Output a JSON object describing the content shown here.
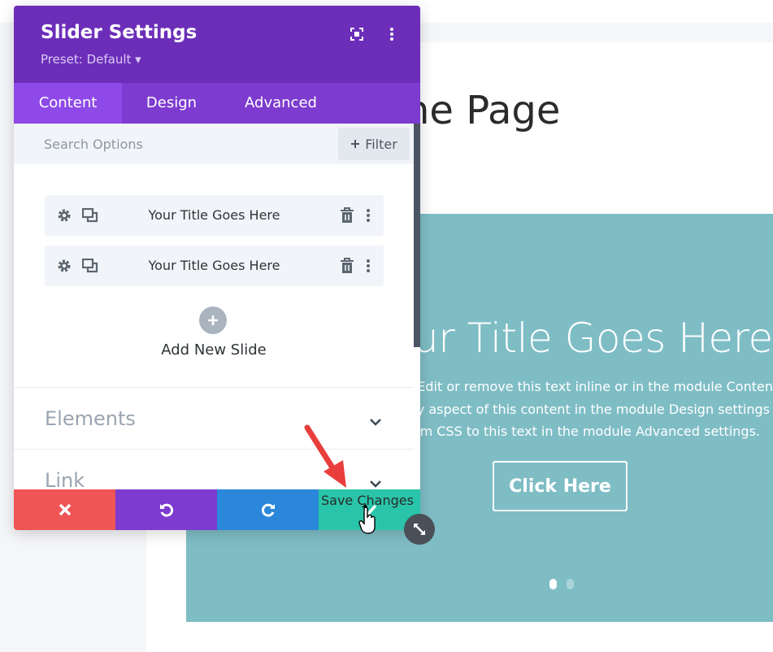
{
  "page": {
    "heading": "ne Page",
    "slider": {
      "title": "ur Title Goes Here",
      "body_lines": [
        "re. Edit or remove this text inline or in the module Conten",
        "ery aspect of this content in the module Design settings",
        "stom CSS to this text in the module Advanced settings."
      ],
      "button_label": "Click Here",
      "dots": [
        "active",
        "inactive"
      ]
    }
  },
  "panel": {
    "title": "Slider Settings",
    "preset": "Preset: Default ▾",
    "tabs": [
      {
        "label": "Content",
        "active": true
      },
      {
        "label": "Design",
        "active": false
      },
      {
        "label": "Advanced",
        "active": false
      }
    ],
    "search": {
      "placeholder": "Search Options"
    },
    "filter_label": "Filter",
    "slides": [
      {
        "label": "Your Title Goes Here"
      },
      {
        "label": "Your Title Goes Here"
      }
    ],
    "add_slide_label": "Add New Slide",
    "sections": [
      {
        "label": "Elements"
      },
      {
        "label": "Link"
      }
    ],
    "bottom_bar": {
      "save_label": "Save Changes"
    }
  },
  "colors": {
    "purple_header": "#6c2eb9",
    "purple_tabs": "#7d3bcf",
    "purple_active_tab": "#8e49e8",
    "cancel": "#ef5555",
    "undo": "#7e3bd0",
    "redo": "#2b87da",
    "save": "#29c4a9",
    "slider_bg": "#7fbdc5"
  },
  "icons": [
    "focus-icon",
    "more-vertical-icon",
    "search-icon",
    "plus-icon",
    "gear-icon",
    "duplicate-icon",
    "trash-icon",
    "kebab-icon",
    "chevron-down-icon",
    "close-icon",
    "undo-icon",
    "redo-icon",
    "resize-icon",
    "arrow-pointer-icon",
    "hand-cursor-icon"
  ]
}
